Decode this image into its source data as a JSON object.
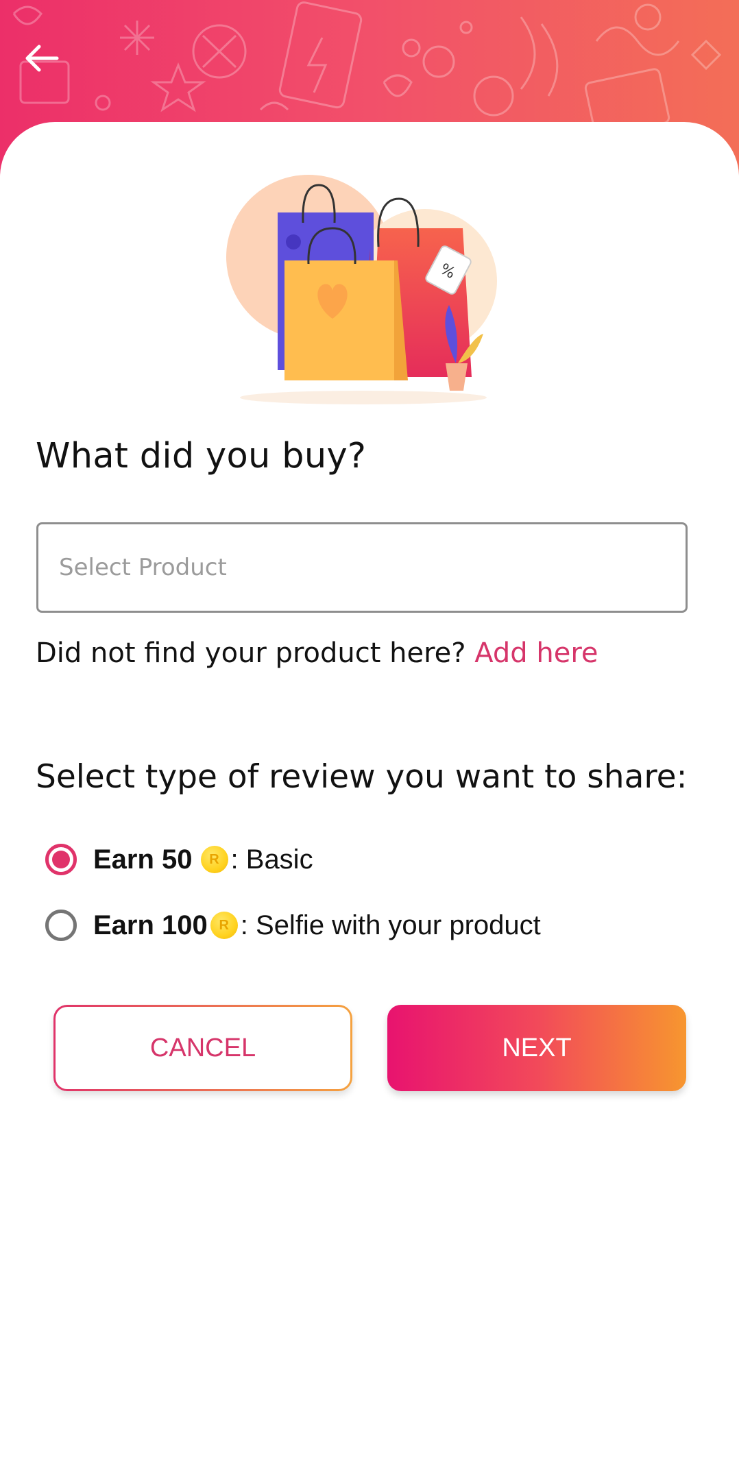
{
  "header": {
    "back_icon": "arrow-left-icon"
  },
  "question": "What did you buy?",
  "product_select": {
    "placeholder": "Select Product"
  },
  "not_found": {
    "text": "Did not find your product here?",
    "link": "Add here"
  },
  "review": {
    "title": "Select type of review you want to share:",
    "options": [
      {
        "earn": "Earn 50",
        "coin_letter": "R",
        "desc": ": Basic",
        "selected": true
      },
      {
        "earn": "Earn 100",
        "coin_letter": "R",
        "desc": ": Selfie with your product",
        "selected": false
      }
    ]
  },
  "buttons": {
    "cancel": "CANCEL",
    "next": "NEXT"
  },
  "colors": {
    "accent": "#e0336a",
    "header_gradient": [
      "#ec2f69",
      "#f36e57"
    ],
    "next_gradient": [
      "#e8136f",
      "#f7962f"
    ]
  }
}
